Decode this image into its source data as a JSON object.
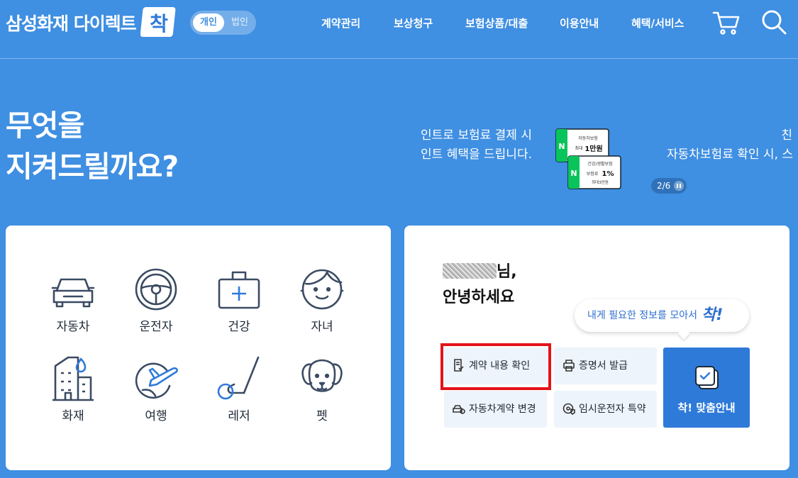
{
  "header": {
    "brand": "삼성화재 다이렉트",
    "brand_badge": "착",
    "toggle": {
      "active": "개인",
      "inactive": "법인"
    },
    "nav": [
      "계약관리",
      "보상청구",
      "보험상품/대출",
      "이용안내",
      "혜택/서비스"
    ]
  },
  "hero": {
    "title_line1": "무엇을",
    "title_line2": "지켜드릴까요?",
    "promo_line1": "인트로 보험료 결제 시",
    "promo_line2": "인트 혜택을 드립니다.",
    "card1_top": "자동차보험",
    "card1_mid": "최대",
    "card1_amount": "1만원",
    "card2_top": "건강/생활보험",
    "card2_mid": "보험료",
    "card2_amount": "1%",
    "card2_bottom": "최대3만원",
    "next_line1": "친",
    "next_line2": "자동차보험료 확인 시, 스",
    "counter": "2/6"
  },
  "categories": [
    {
      "label": "자동차",
      "icon": "car-icon"
    },
    {
      "label": "운전자",
      "icon": "steering-wheel-icon"
    },
    {
      "label": "건강",
      "icon": "first-aid-kit-icon"
    },
    {
      "label": "자녀",
      "icon": "child-face-icon"
    },
    {
      "label": "화재",
      "icon": "building-fire-icon"
    },
    {
      "label": "여행",
      "icon": "airplane-globe-icon"
    },
    {
      "label": "레저",
      "icon": "golf-club-icon"
    },
    {
      "label": "펫",
      "icon": "dog-icon"
    }
  ],
  "user": {
    "greeting_suffix": "님,",
    "greeting": "안녕하세요"
  },
  "bubble": {
    "text": "내게 필요한 정보를 모아서",
    "emphasis": "착!"
  },
  "quick": {
    "contract_check": "계약 내용 확인",
    "certificate": "증명서 발급",
    "car_change": "자동차계약 변경",
    "temp_driver": "임시운전자 특약",
    "custom_guide": "착! 맞춤안내"
  },
  "colors": {
    "background": "#3f8fe2",
    "accent": "#2e7ad9",
    "highlight": "#e3121b",
    "icon_stroke": "#3b4b63"
  }
}
